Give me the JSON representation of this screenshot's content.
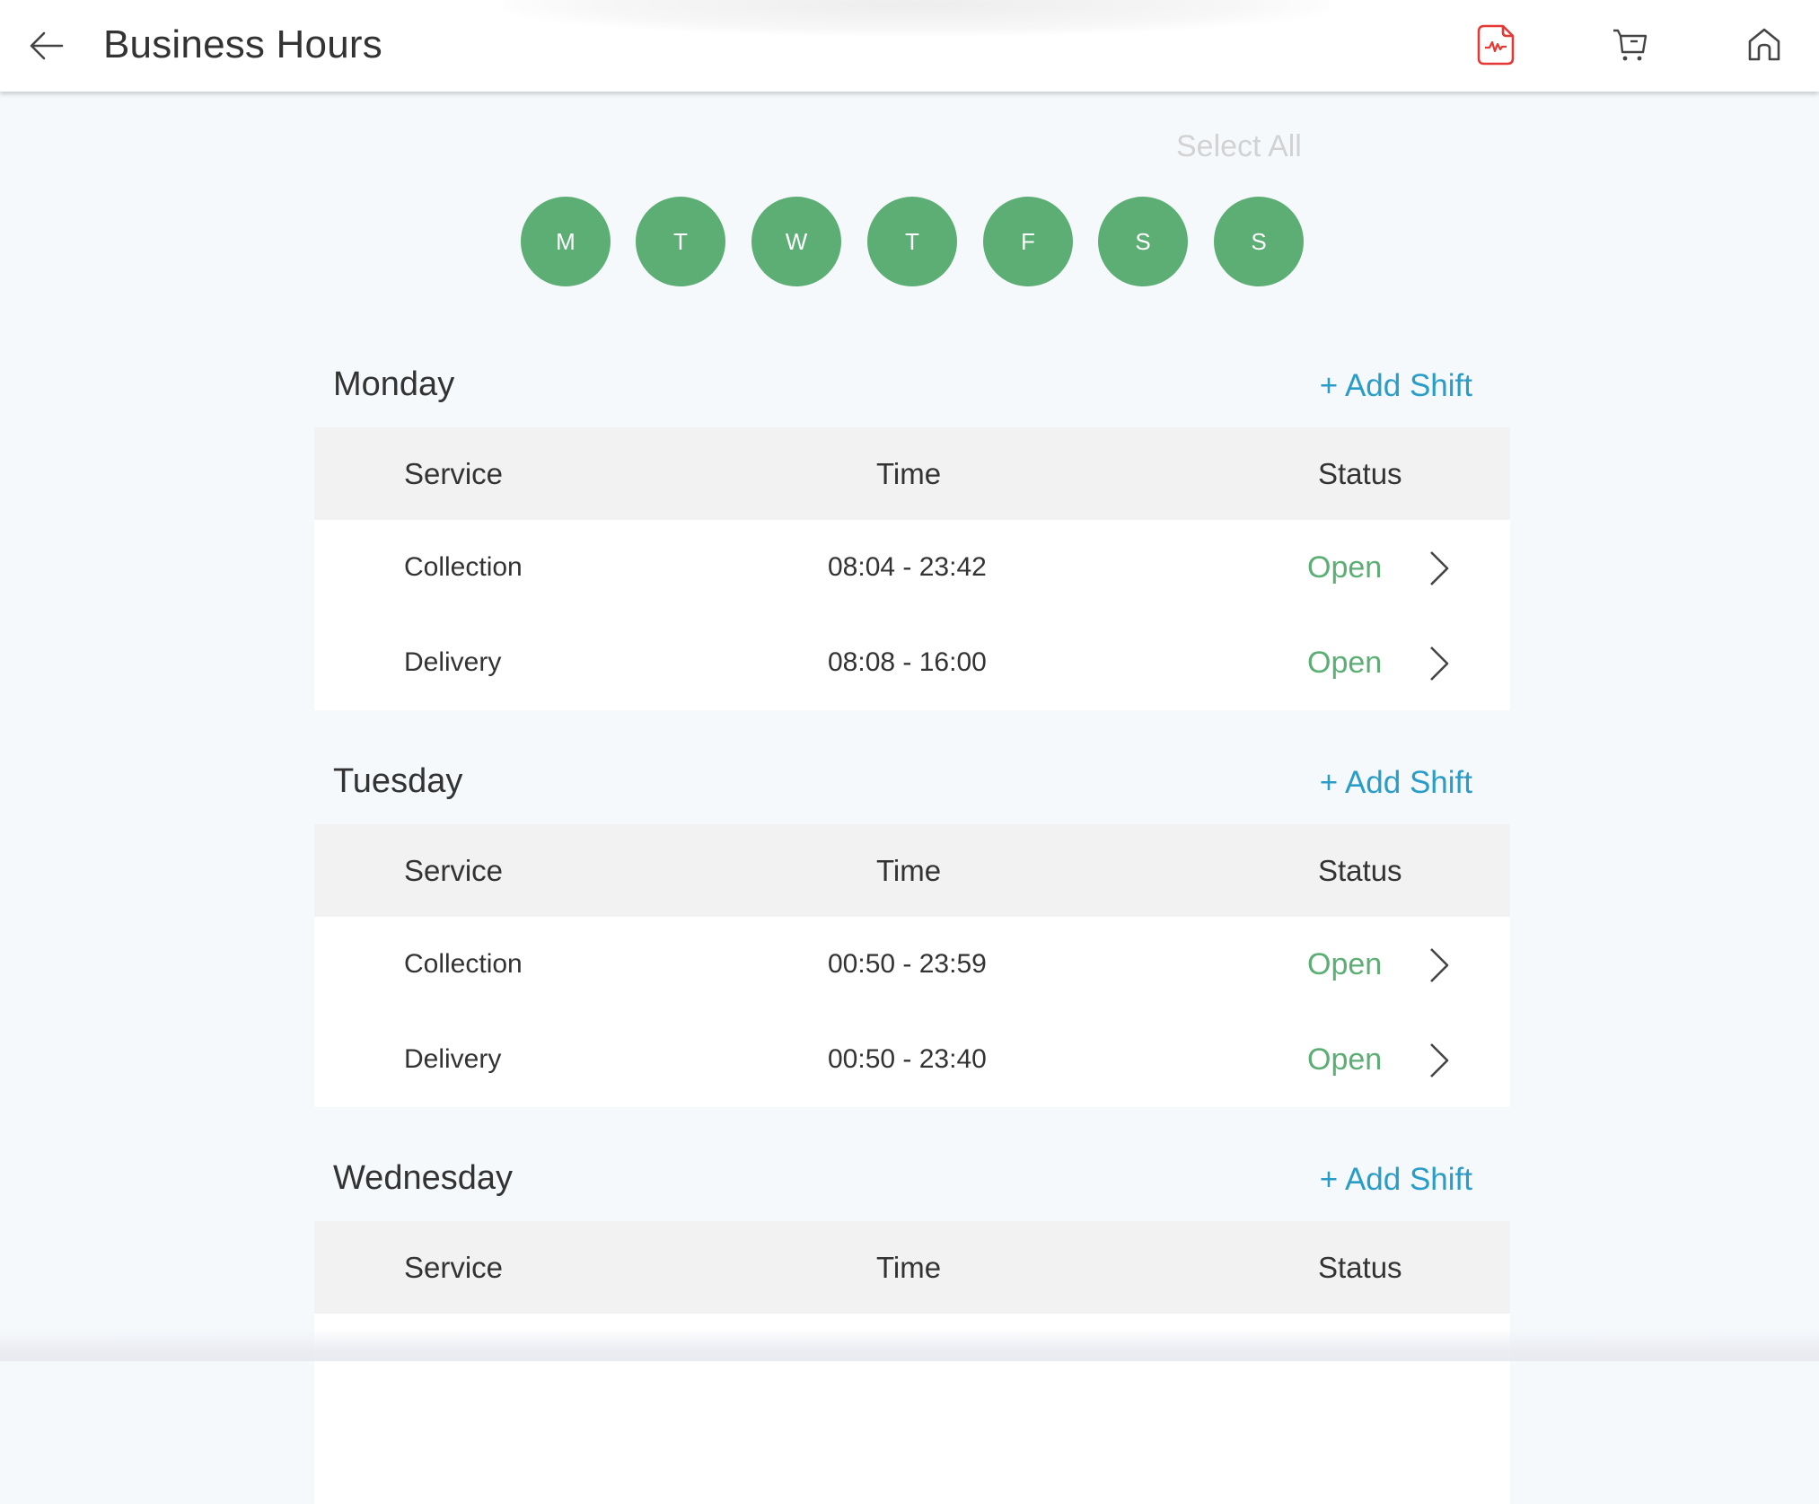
{
  "header": {
    "title": "Business Hours",
    "back_icon": "arrow-left-icon",
    "icons": [
      {
        "name": "report-file-icon",
        "color": "#e53935"
      },
      {
        "name": "cart-icon",
        "color": "#444444"
      },
      {
        "name": "home-icon",
        "color": "#444444"
      }
    ]
  },
  "day_selector": {
    "select_all_label": "Select All",
    "days": [
      {
        "letter": "M",
        "selected": true
      },
      {
        "letter": "T",
        "selected": true
      },
      {
        "letter": "W",
        "selected": true
      },
      {
        "letter": "T",
        "selected": true
      },
      {
        "letter": "F",
        "selected": true
      },
      {
        "letter": "S",
        "selected": true
      },
      {
        "letter": "S",
        "selected": true
      }
    ],
    "selected_color": "#5cae74"
  },
  "columns": {
    "service": "Service",
    "time": "Time",
    "status": "Status"
  },
  "add_shift_label": "+ Add Shift",
  "colors": {
    "accent_link": "#2a9cc8",
    "status_open": "#5cae74"
  },
  "schedule": [
    {
      "day": "Monday",
      "rows": [
        {
          "service": "Collection",
          "time": "08:04 - 23:42",
          "status": "Open"
        },
        {
          "service": "Delivery",
          "time": "08:08 - 16:00",
          "status": "Open"
        }
      ]
    },
    {
      "day": "Tuesday",
      "rows": [
        {
          "service": "Collection",
          "time": "00:50 - 23:59",
          "status": "Open"
        },
        {
          "service": "Delivery",
          "time": "00:50 - 23:40",
          "status": "Open"
        }
      ]
    },
    {
      "day": "Wednesday",
      "rows": []
    }
  ]
}
